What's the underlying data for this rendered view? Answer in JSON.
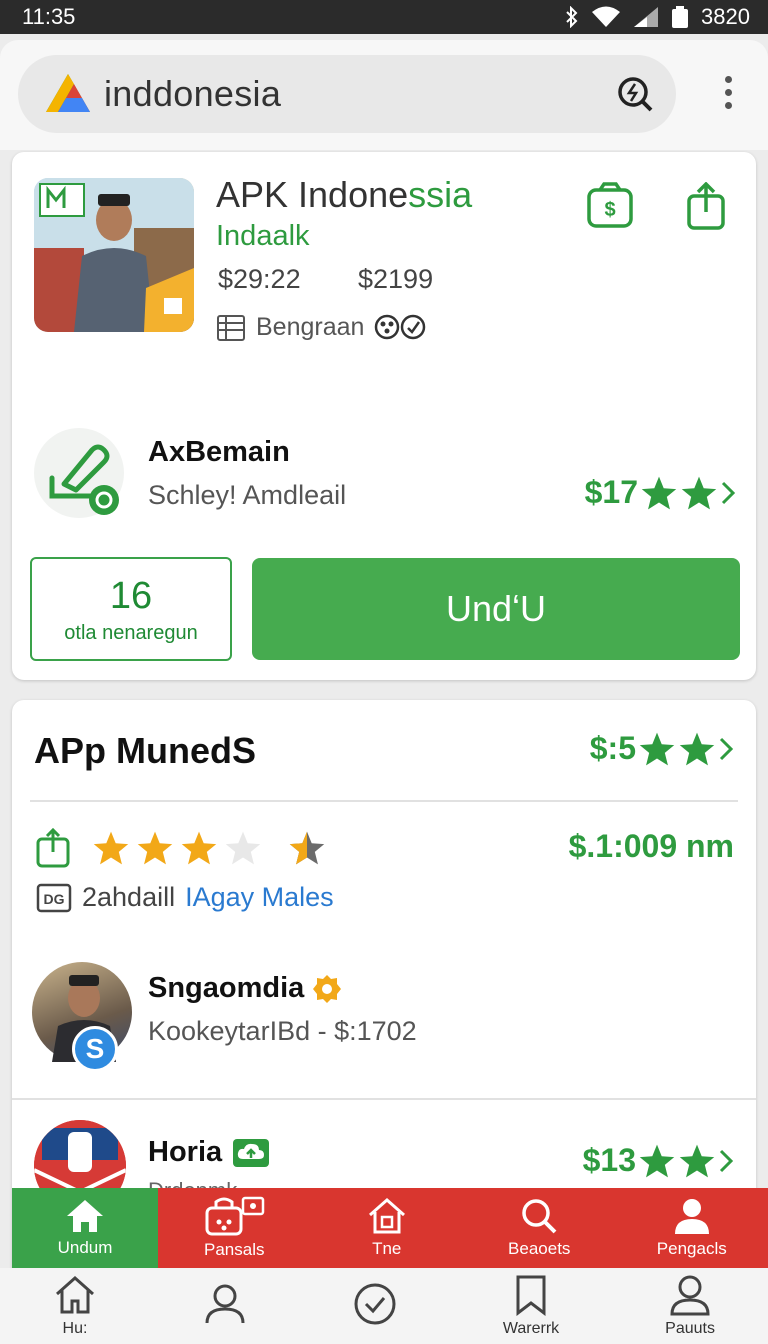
{
  "status_bar": {
    "time": "11:35",
    "battery": "3820"
  },
  "search_bar": {
    "brand_text": "inddonesia"
  },
  "app_card": {
    "title_main": "APK Indone",
    "title_highlight": "ssia",
    "subtitle": "Indaalk",
    "price_a": "$29:22",
    "price_b": "$2199",
    "category": "Bengraan",
    "developer": {
      "name": "AxBemain",
      "subtitle": "Schley! Amdleail",
      "price": "$17"
    },
    "counter": {
      "value": "16",
      "label": "otla nenaregun"
    },
    "install_label": "UndʻU"
  },
  "apps_section": {
    "title": "APp MunedS",
    "price": "$:5",
    "rating": {
      "value": 3.5,
      "max": 5
    },
    "rating_price": "$.1:009 nm",
    "tag_text": "2ahdaill",
    "tag_link": "IAgay Males",
    "publisher": {
      "name": "Sngaomdia",
      "subtitle": "KookeytarIBd - $:1702",
      "badge_letter": "S"
    },
    "horia": {
      "name": "Horia",
      "price": "$13",
      "peek": "Drdenmk"
    }
  },
  "bottom_tabs": [
    {
      "label": "Undum",
      "icon": "home-icon",
      "active": true
    },
    {
      "label": "Pansals",
      "icon": "bag-icon",
      "active": false
    },
    {
      "label": "Tne",
      "icon": "house-icon",
      "active": false
    },
    {
      "label": "Beaoets",
      "icon": "search-icon",
      "active": false
    },
    {
      "label": "Pengacls",
      "icon": "person-icon",
      "active": false
    }
  ],
  "system_nav": [
    {
      "label": "Hu:",
      "icon": "home-outline-icon"
    },
    {
      "label": "",
      "icon": "person-outline-icon"
    },
    {
      "label": "",
      "icon": "check-circle-icon"
    },
    {
      "label": "Warerrk",
      "icon": "bookmark-icon"
    },
    {
      "label": "Pauuts",
      "icon": "account-icon"
    }
  ],
  "colors": {
    "accent": "#2e9b3f",
    "button": "#46ab4f",
    "nav_red": "#d9362f",
    "star": "#f2a818",
    "link": "#2a7ad0"
  }
}
